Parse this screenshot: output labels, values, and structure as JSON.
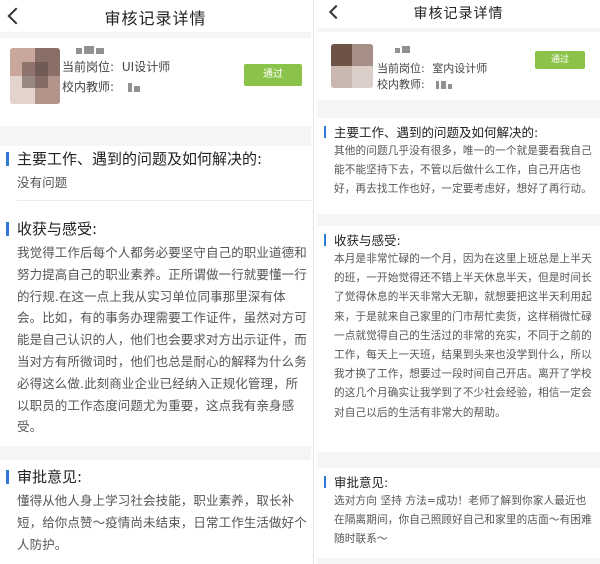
{
  "left": {
    "title": "审核记录详情",
    "profile": {
      "position_label": "当前岗位:",
      "position_value": "UI设计师",
      "teacher_label": "校内教师:",
      "status": "通过"
    },
    "sections": [
      {
        "title": "主要工作、遇到的问题及如何解决的:",
        "body": "没有问题"
      },
      {
        "title": "收获与感受:",
        "body": "我觉得工作后每个人都务必要坚守自己的职业道德和努力提高自己的职业素养。正所谓做一行就要懂一行的行规.在这一点上我从实习单位同事那里深有体会。比如，有的事务办理需要工作证件，虽然对方可能是自己认识的人，他们也会要求对方出示证件，而当对方有所微词时，他们也总是耐心的解释为什么务必得这么做.此刻商业企业已经纳入正规化管理，所以职员的工作态度问题尤为重要，这点我有亲身感受。"
      },
      {
        "title": "审批意见:",
        "body": "懂得从他人身上学习社会技能，职业素养，取长补短，给你点赞～疫情尚未结束，日常工作生活做好个人防护。"
      }
    ]
  },
  "right": {
    "title": "审核记录详情",
    "profile": {
      "position_label": "当前岗位:",
      "position_value": "室内设计师",
      "teacher_label": "校内教师:",
      "status": "通过"
    },
    "sections": [
      {
        "title": "主要工作、遇到的问题及如何解决的:",
        "body": "其他的问题几乎没有很多，唯一的一个就是要看我自己能不能坚持下去，不管以后做什么工作，自己开店也好，再去找工作也好，一定要考虑好，想好了再行动。"
      },
      {
        "title": "收获与感受:",
        "body": "本月是非常忙碌的一个月，因为在这里上班总是上半天的班，一开始觉得还不错上半天休息半天，但是时间长了觉得休息的半天非常大无聊，就想要把这半天利用起来，于是就来自己家里的门市帮忙卖货，这样稍微忙碌一点就觉得自己的生活过的非常的充实，不同于之前的工作，每天上一天班，结果到头来也没学到什么，所以我才换了工作，想要过一段时间自己开店。离开了学校的这几个月确实让我学到了不少社会经验，相信一定会对自己以后的生活有非常大的帮助。"
      },
      {
        "title": "审批意见:",
        "body": "选对方向 坚持 方法=成功！老师了解到你家人最近也在隔离期间，你自己照顾好自己和家里的店面～有困难随时联系～"
      }
    ]
  }
}
